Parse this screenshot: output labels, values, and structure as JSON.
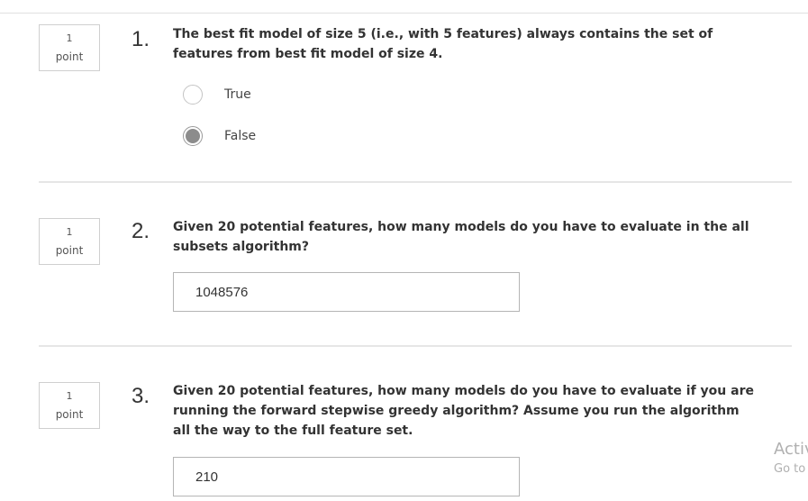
{
  "questions": [
    {
      "points_value": "1",
      "points_label": "point",
      "number": "1.",
      "text": "The best fit model of size 5 (i.e., with 5 features) always contains the set of features from best fit model of size 4.",
      "options": [
        {
          "label": "True",
          "selected": false
        },
        {
          "label": "False",
          "selected": true
        }
      ]
    },
    {
      "points_value": "1",
      "points_label": "point",
      "number": "2.",
      "text": "Given 20 potential features, how many models do you have to evaluate in the all subsets algorithm?",
      "answer": "1048576"
    },
    {
      "points_value": "1",
      "points_label": "point",
      "number": "3.",
      "text": "Given 20 potential features, how many models do you have to evaluate if you are running the forward stepwise greedy algorithm? Assume you run the algorithm all the way to the full feature set.",
      "answer": "210"
    }
  ],
  "watermark": {
    "title": "Activ",
    "subtitle": "Go to"
  },
  "colors": {
    "selected_radio": "#8c8c8c",
    "divider": "#e6e6e6"
  }
}
